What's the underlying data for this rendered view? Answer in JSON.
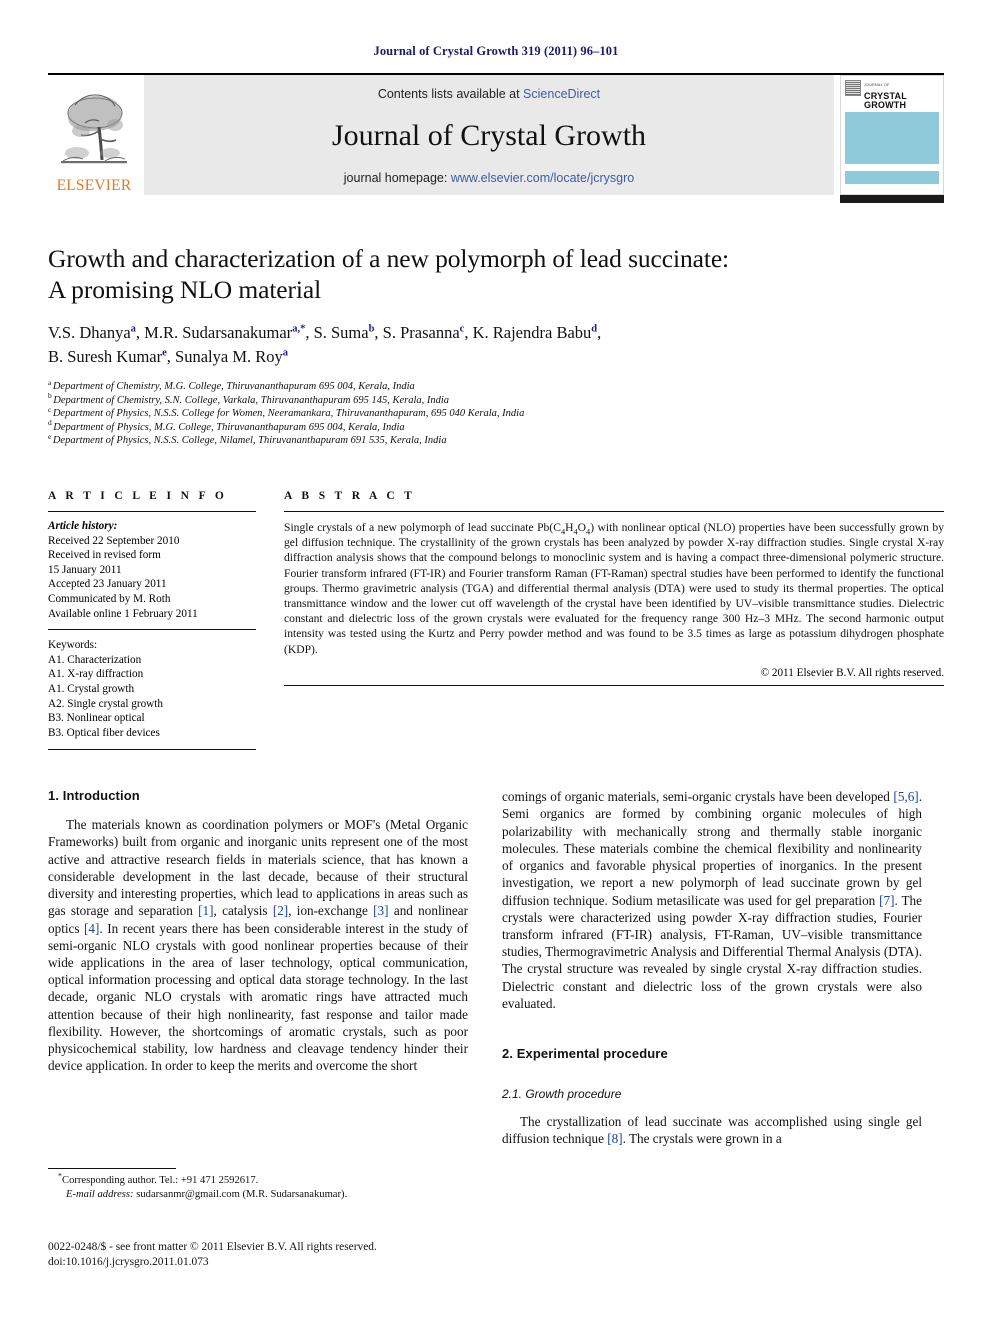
{
  "running_head": "Journal of Crystal Growth 319 (2011) 96–101",
  "masthead": {
    "elsevier_wordmark": "ELSEVIER",
    "contents_prefix": "Contents lists available at ",
    "sciencedirect": "ScienceDirect",
    "journal_name": "Journal of Crystal Growth",
    "homepage_prefix": "journal homepage: ",
    "homepage_url": "www.elsevier.com/locate/jcrysgro",
    "cover": {
      "kicker": "JOURNAL OF",
      "line1": "CRYSTAL",
      "line2": "GROWTH"
    },
    "colors": {
      "banner_bg": "#e9e9e9",
      "link_blue": "#3b5ca8",
      "elsevier_orange": "#e87722",
      "cover_blue": "#8ecada"
    }
  },
  "article": {
    "title_line1": "Growth and characterization of a new polymorph of lead succinate:",
    "title_line2": "A promising NLO material",
    "authors": [
      {
        "name": "V.S. Dhanya",
        "sup": "a",
        "sep": ", "
      },
      {
        "name": "M.R. Sudarsanakumar",
        "sup": "a,*",
        "sep": ", "
      },
      {
        "name": "S. Suma",
        "sup": "b",
        "sep": ", "
      },
      {
        "name": "S. Prasanna",
        "sup": "c",
        "sep": ", "
      },
      {
        "name": "K. Rajendra Babu",
        "sup": "d",
        "sep": ","
      },
      {
        "name": "B. Suresh Kumar",
        "sup": "e",
        "sep": ", "
      },
      {
        "name": "Sunalya M. Roy",
        "sup": "a",
        "sep": ""
      }
    ],
    "affiliations": [
      {
        "mark": "a",
        "text": "Department of Chemistry, M.G. College, Thiruvananthapuram 695 004, Kerala, India"
      },
      {
        "mark": "b",
        "text": "Department of Chemistry, S.N. College, Varkala, Thiruvananthapuram 695 145, Kerala, India"
      },
      {
        "mark": "c",
        "text": "Department of Physics, N.S.S. College for Women, Neeramankara, Thiruvananthapuram, 695 040 Kerala, India"
      },
      {
        "mark": "d",
        "text": "Department of Physics, M.G. College, Thiruvananthapuram 695 004, Kerala, India"
      },
      {
        "mark": "e",
        "text": "Department of Physics, N.S.S. College, Nilamel, Thiruvananthapuram 691 535, Kerala, India"
      }
    ]
  },
  "article_info": {
    "heading": "A R T I C L E   I N F O",
    "history_label": "Article history:",
    "history": [
      "Received 22 September 2010",
      "Received in revised form",
      "15 January 2011",
      "Accepted 23 January 2011",
      "Communicated by M. Roth",
      "Available online 1 February 2011"
    ],
    "keywords_label": "Keywords:",
    "keywords": [
      "A1. Characterization",
      "A1. X-ray diffraction",
      "A1. Crystal growth",
      "A2. Single crystal growth",
      "B3. Nonlinear optical",
      "B3. Optical fiber devices"
    ]
  },
  "abstract": {
    "heading": "A B S T R A C T",
    "part1": "Single crystals of a new polymorph of lead succinate Pb(C",
    "sub1": "4",
    "part2": "H",
    "sub2": "4",
    "part3": "O",
    "sub3": "4",
    "part4": ") with nonlinear optical (NLO) properties have been successfully grown by gel diffusion technique. The crystallinity of the grown crystals has been analyzed by powder X-ray diffraction studies. Single crystal X-ray diffraction analysis shows that the compound belongs to monoclinic system and is having a compact three-dimensional polymeric structure. Fourier transform infrared (FT-IR) and Fourier transform Raman (FT-Raman) spectral studies have been performed to identify the functional groups. Thermo gravimetric analysis (TGA) and differential thermal analysis (DTA) were used to study its thermal properties. The optical transmittance window and the lower cut off wavelength of the crystal have been identified by UV–visible transmittance studies. Dielectric constant and dielectric loss of the grown crystals were evaluated for the frequency range 300 Hz–3 MHz. The second harmonic output intensity was tested using the Kurtz and Perry powder method and was found to be 3.5 times as large as potassium dihydrogen phosphate (KDP).",
    "copyright": "© 2011 Elsevier B.V. All rights reserved."
  },
  "sections": {
    "intro_heading": "1.  Introduction",
    "intro_p1_a": "The materials known as coordination polymers or MOF's (Metal Organic Frameworks) built from organic and inorganic units represent one of the most active and attractive research fields in materials science, that has known a considerable development in the last decade, because of their structural diversity and interesting properties, which lead to applications in areas such as gas storage and separation ",
    "ref1": "[1]",
    "intro_p1_b": ", catalysis ",
    "ref2": "[2]",
    "intro_p1_c": ", ion-exchange ",
    "ref3": "[3]",
    "intro_p1_d": " and nonlinear optics ",
    "ref4": "[4]",
    "intro_p1_e": ". In recent years there has been considerable interest in the study of semi-organic NLO crystals with good nonlinear properties because of their wide applications in the area of laser technology, optical communication, optical information processing and optical data storage technology. In the last decade, organic NLO crystals with aromatic rings have attracted much attention because of their high nonlinearity, fast response and tailor made flexibility. However, the shortcomings of aromatic crystals, such as poor physicochemical stability, low hardness and cleavage tendency hinder their device application. In order to keep the merits and overcome the short",
    "intro_p1_cont_a": "comings of organic materials, semi-organic crystals have been developed ",
    "ref56": "[5,6]",
    "intro_p1_cont_b": ". Semi organics are formed by combining organic molecules of high polarizability with mechanically strong and thermally stable inorganic molecules. These materials combine the chemical flexibility and nonlinearity of organics and favorable physical properties of inorganics. In the present investigation, we report a new polymorph of lead succinate grown by gel diffusion technique. Sodium metasilicate was used for gel preparation ",
    "ref7": "[7]",
    "intro_p1_cont_c": ". The crystals were characterized using powder X-ray diffraction studies, Fourier transform infrared (FT-IR) analysis, FT-Raman, UV–visible transmittance studies, Thermogravimetric Analysis and Differential Thermal Analysis (DTA). The crystal structure was revealed by single crystal X-ray diffraction studies. Dielectric constant and dielectric loss of the grown crystals were also evaluated.",
    "exp_heading": "2.  Experimental procedure",
    "growth_heading": "2.1.  Growth procedure",
    "growth_p1_a": "The crystallization of lead succinate was accomplished using single gel diffusion technique ",
    "ref8": "[8]",
    "growth_p1_b": ". The crystals were grown in a"
  },
  "footer": {
    "corresponding": "Corresponding author. Tel.: +91 471 2592617.",
    "email_label": "E-mail address:",
    "email": " sudarsanmr@gmail.com (M.R. Sudarsanakumar).",
    "issn_line": "0022-0248/$ - see front matter © 2011 Elsevier B.V. All rights reserved.",
    "doi_line": "doi:10.1016/j.jcrysgro.2011.01.073"
  }
}
